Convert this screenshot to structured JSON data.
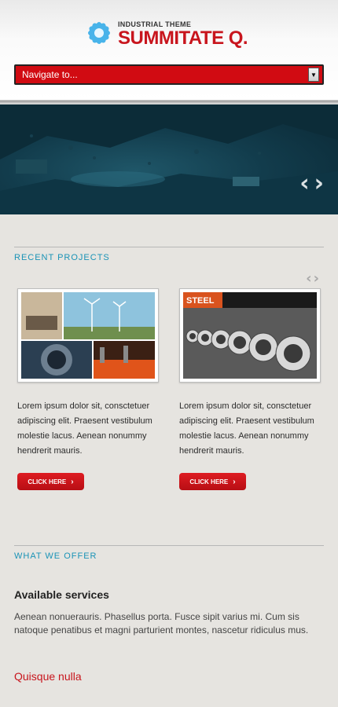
{
  "brand": {
    "tagline": "INDUSTRIAL THEME",
    "name": "SUMMITATE Q.",
    "accent": "#c8151d"
  },
  "nav": {
    "placeholder": "Navigate to..."
  },
  "hero": {
    "prev_icon": "chevron-left-icon",
    "next_icon": "chevron-right-icon"
  },
  "recent_projects": {
    "title": "RECENT PROJECTS",
    "items": [
      {
        "text": "Lorem ipsum dolor sit, consctetuer adipiscing elit. Praesent vestibulum molestie lacus. Aenean nonummy hendrerit mauris.",
        "button": "CLICK HERE"
      },
      {
        "text": "Lorem ipsum dolor sit, consctetuer adipiscing elit. Praesent vestibulum molestie lacus. Aenean nonummy hendrerit mauris.",
        "button": "CLICK HERE",
        "image_label": "STEEL"
      }
    ]
  },
  "offer": {
    "title": "WHAT WE OFFER",
    "heading": "Available services",
    "text": "Aenean nonuerauris. Phasellus porta. Fusce sipit varius mi. Cum sis natoque penatibus et magni parturient montes, nascetur ridiculus mus.",
    "subheading": "Quisque nulla"
  },
  "colors": {
    "section_title": "#1a93b6",
    "button": "#d10b12"
  }
}
